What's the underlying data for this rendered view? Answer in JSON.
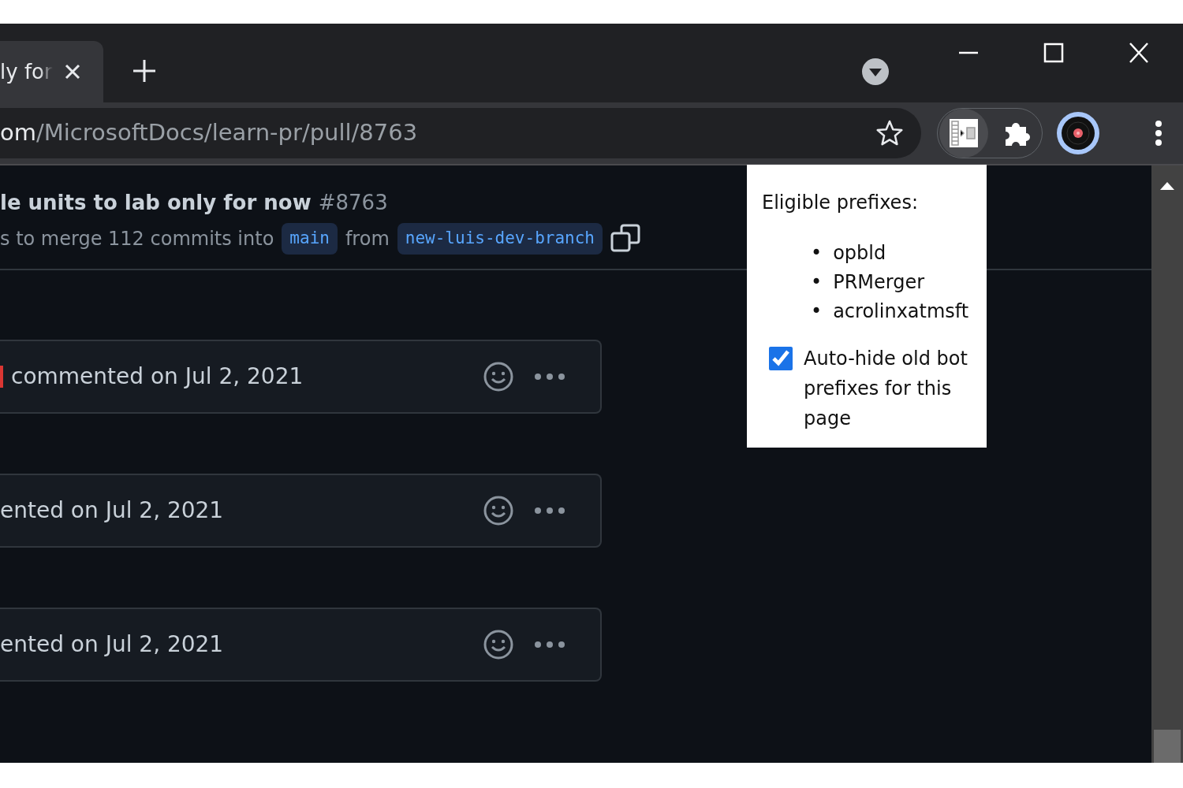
{
  "tab": {
    "title": "ly for"
  },
  "address": {
    "host": "om",
    "path": "/MicrosoftDocs/learn-pr/pull/8763"
  },
  "pull_request": {
    "title": "le units to lab only for now",
    "number": "#8763",
    "merge_text": "s to merge 112 commits into",
    "base_branch": "main",
    "from_text": "from",
    "head_branch": "new-luis-dev-branch"
  },
  "comments": [
    {
      "text": "commented on Jul 2, 2021",
      "color": "#da3633"
    },
    {
      "text": "ented on Jul 2, 2021"
    },
    {
      "text": "ented on Jul 2, 2021"
    }
  ],
  "popup": {
    "title": "Eligible prefixes:",
    "prefixes": [
      {
        "bullet": "•",
        "name": "opbld"
      },
      {
        "bullet": "•",
        "name": "PRMerger"
      },
      {
        "bullet": "•",
        "name": "acrolinxatmsft"
      }
    ],
    "auto_hide": {
      "label": "Auto-hide old bot prefixes for this page",
      "checked": true
    }
  }
}
